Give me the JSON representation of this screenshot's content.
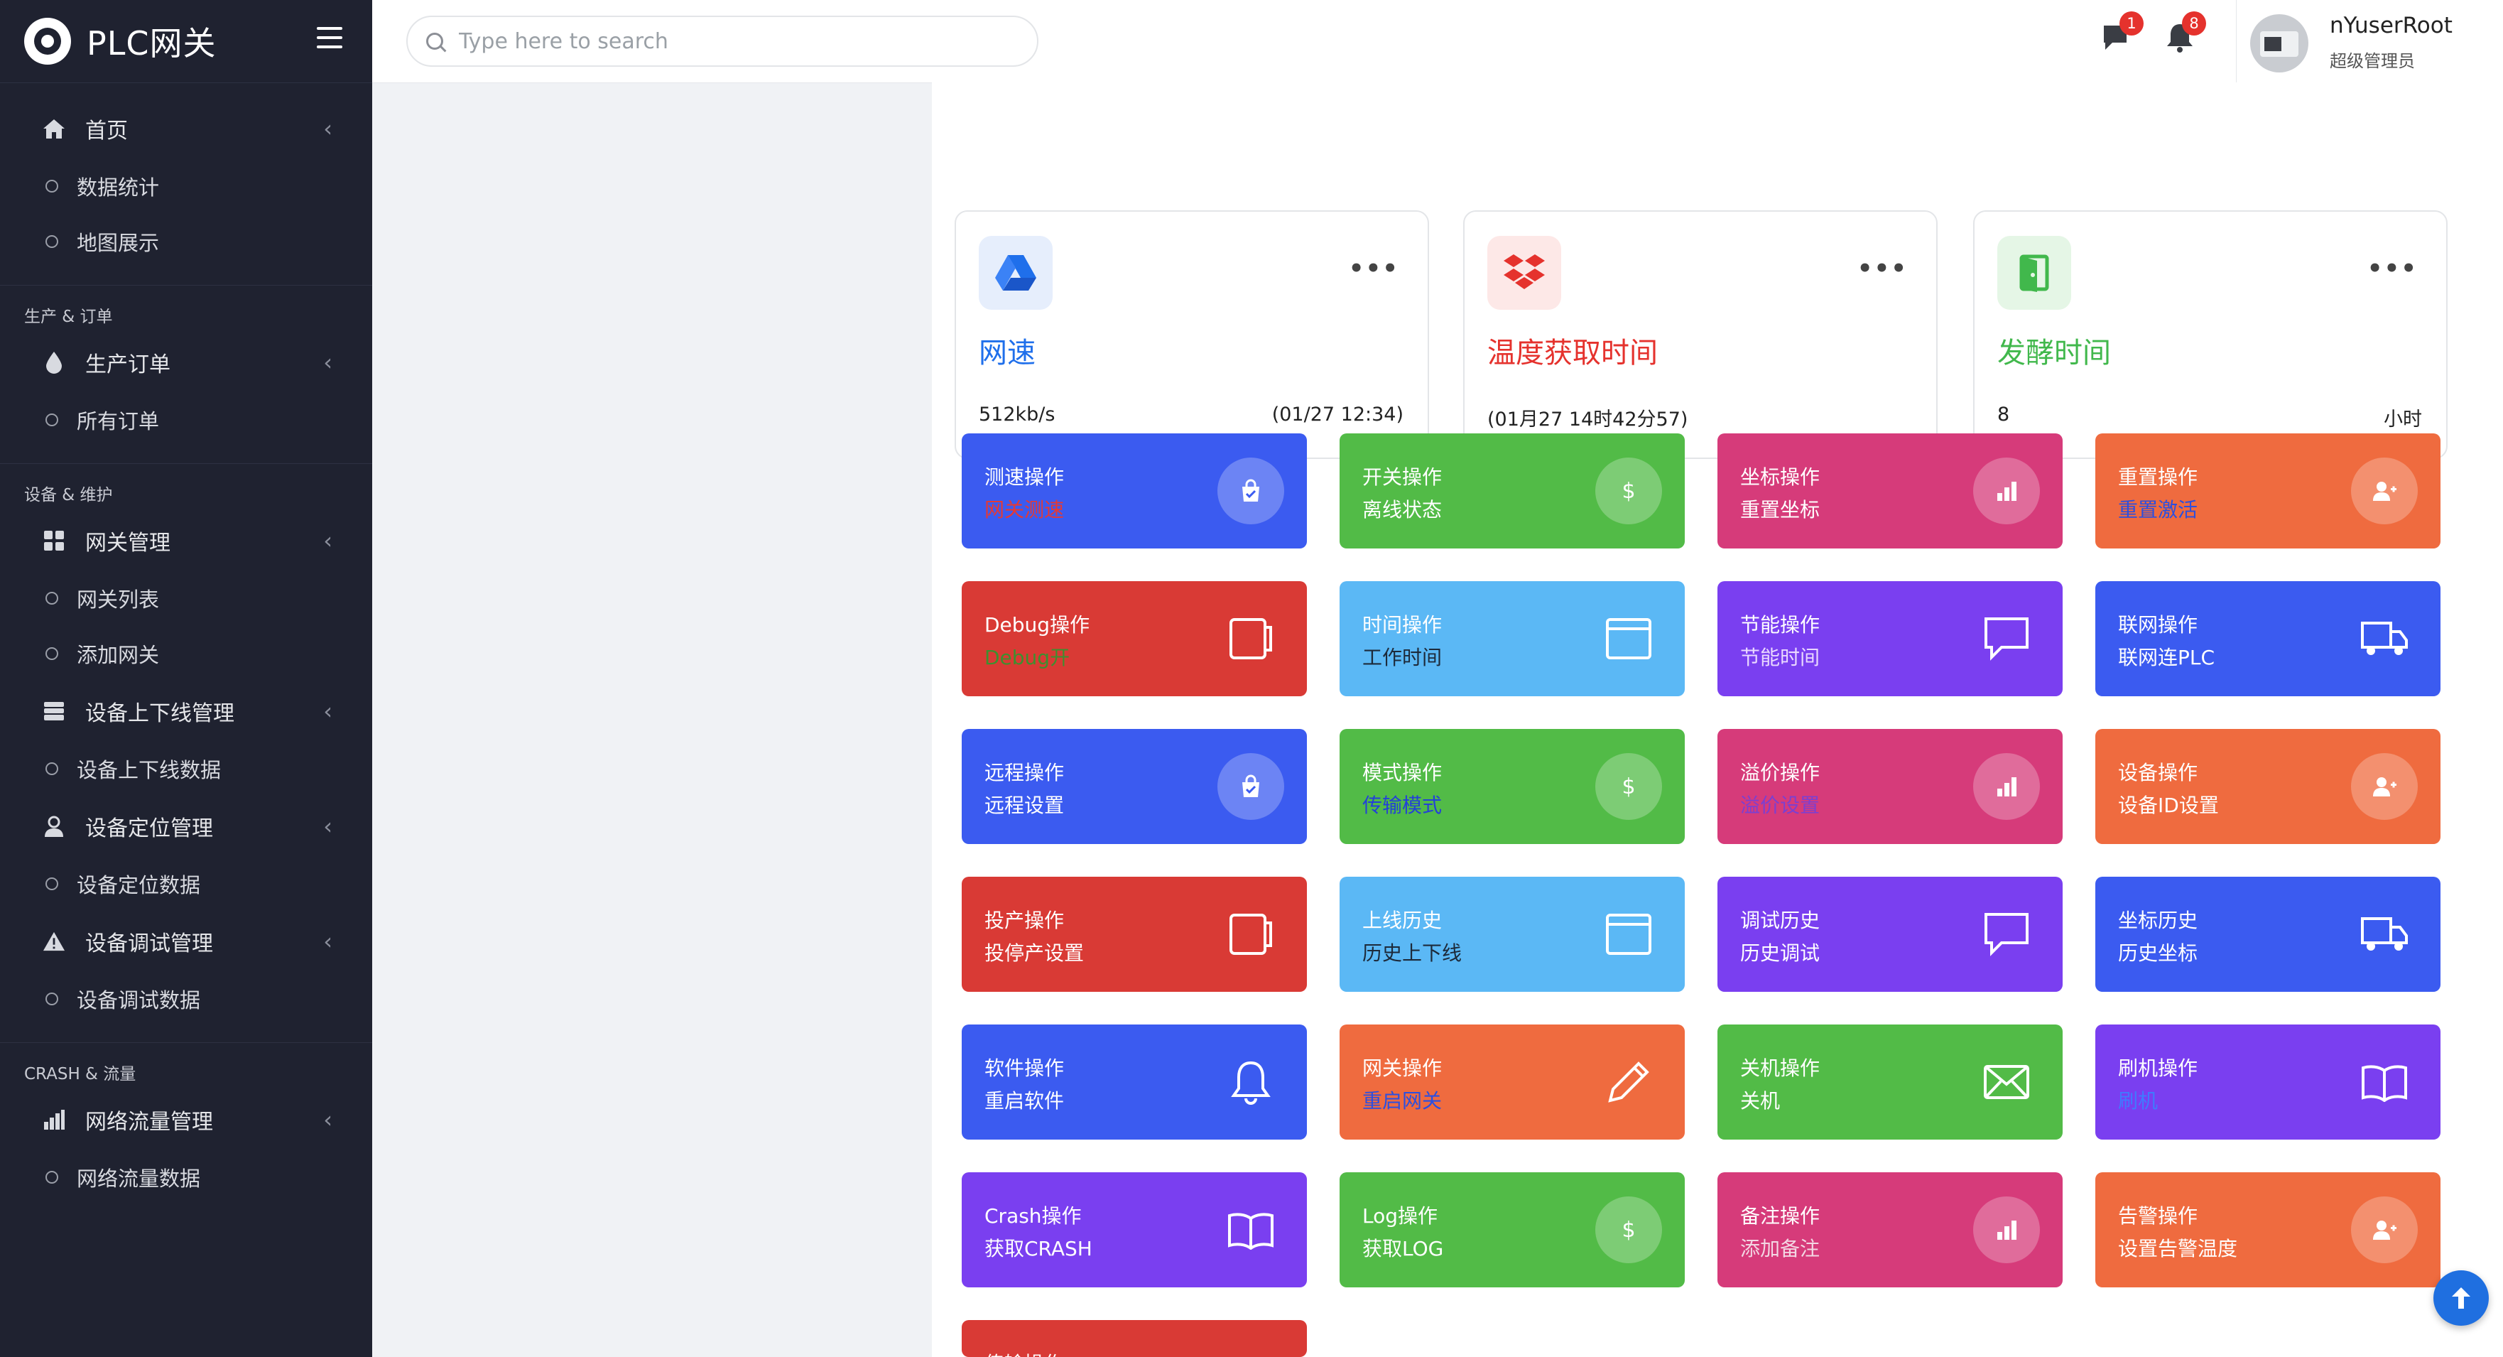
{
  "brand": {
    "title": "PLC网关"
  },
  "search": {
    "placeholder": "Type here to search"
  },
  "notifications": {
    "messages_count": "1",
    "alerts_count": "8"
  },
  "user": {
    "name": "nYuserRoot",
    "role": "超级管理员"
  },
  "sidebar": {
    "home": {
      "label": "首页",
      "children": [
        "数据统计",
        "地图展示"
      ]
    },
    "section_production": "生产 & 订单",
    "orders": {
      "label": "生产订单",
      "children": [
        "所有订单"
      ]
    },
    "section_devices": "设备 & 维护",
    "gateway": {
      "label": "网关管理",
      "children": [
        "网关列表",
        "添加网关"
      ]
    },
    "online": {
      "label": "设备上下线管理",
      "children": [
        "设备上下线数据"
      ]
    },
    "location": {
      "label": "设备定位管理",
      "children": [
        "设备定位数据"
      ]
    },
    "debug": {
      "label": "设备调试管理",
      "children": [
        "设备调试数据"
      ]
    },
    "section_crash": "CRASH & 流量",
    "traffic": {
      "label": "网络流量管理",
      "children": [
        "网络流量数据"
      ]
    }
  },
  "stats": [
    {
      "title": "网速",
      "value": "512kb/s",
      "side": "(01/27 12:34)",
      "icon": "google-drive-icon",
      "color": "#1f6feb",
      "bg": "#e6eefc"
    },
    {
      "title": "温度获取时间",
      "value": "(01月27 14时42分57)",
      "side": "",
      "icon": "dropbox-icon",
      "color": "#e5322d",
      "bg": "#fde8e7"
    },
    {
      "title": "发酵时间",
      "value": "8",
      "side": "小时",
      "icon": "door-icon",
      "color": "#41b84c",
      "bg": "#e5f6e6"
    }
  ],
  "tiles": [
    {
      "label": "测速操作",
      "sub": "网关测速",
      "bg": "#3b5bf0",
      "subColor": "#e53935",
      "icon": "shopping-bag-icon"
    },
    {
      "label": "开关操作",
      "sub": "离线状态",
      "bg": "#52bb47",
      "subColor": "#ffffff",
      "icon": "dollar-icon"
    },
    {
      "label": "坐标操作",
      "sub": "重置坐标",
      "bg": "#d63b7a",
      "subColor": "#ffffff",
      "icon": "bar-chart-icon"
    },
    {
      "label": "重置操作",
      "sub": "重置激活",
      "bg": "#ef6b3f",
      "subColor": "#2b4fe0",
      "icon": "user-plus-icon"
    },
    {
      "label": "Debug操作",
      "sub": "Debug开",
      "bg": "#d93a35",
      "subColor": "#3e8f2f",
      "icon": "tablet-icon"
    },
    {
      "label": "时间操作",
      "sub": "工作时间",
      "bg": "#5bb8f5",
      "subColor": "#1d2a3a",
      "icon": "browser-icon"
    },
    {
      "label": "节能操作",
      "sub": "节能时间",
      "bg": "#7a3ff0",
      "subColor": "#ead8ff",
      "icon": "chat-icon"
    },
    {
      "label": "联网操作",
      "sub": "联网连PLC",
      "bg": "#3b5bf0",
      "subColor": "#ffffff",
      "icon": "truck-icon"
    },
    {
      "label": "远程操作",
      "sub": "远程设置",
      "bg": "#3b5bf0",
      "subColor": "#ffffff",
      "icon": "shopping-bag-icon"
    },
    {
      "label": "模式操作",
      "sub": "传输模式",
      "bg": "#52bb47",
      "subColor": "#2340d8",
      "icon": "dollar-icon"
    },
    {
      "label": "溢价操作",
      "sub": "溢价设置",
      "bg": "#d63b7a",
      "subColor": "#7d3fd0",
      "icon": "bar-chart-icon"
    },
    {
      "label": "设备操作",
      "sub": "设备ID设置",
      "bg": "#ef6b3f",
      "subColor": "#ffffff",
      "icon": "user-plus-icon"
    },
    {
      "label": "投产操作",
      "sub": "投停产设置",
      "bg": "#d93a35",
      "subColor": "#ffffff",
      "icon": "tablet-icon"
    },
    {
      "label": "上线历史",
      "sub": "历史上下线",
      "bg": "#5bb8f5",
      "subColor": "#1d2a3a",
      "icon": "browser-icon"
    },
    {
      "label": "调试历史",
      "sub": "历史调试",
      "bg": "#7a3ff0",
      "subColor": "#ffffff",
      "icon": "chat-icon"
    },
    {
      "label": "坐标历史",
      "sub": "历史坐标",
      "bg": "#3b5bf0",
      "subColor": "#ffffff",
      "icon": "truck-icon"
    },
    {
      "label": "软件操作",
      "sub": "重启软件",
      "bg": "#3b5bf0",
      "subColor": "#ffffff",
      "icon": "bell-icon"
    },
    {
      "label": "网关操作",
      "sub": "重启网关",
      "bg": "#ef6b3f",
      "subColor": "#2b4fe0",
      "icon": "pencil-icon"
    },
    {
      "label": "关机操作",
      "sub": "关机",
      "bg": "#52bb47",
      "subColor": "#ffffff",
      "icon": "envelope-icon"
    },
    {
      "label": "刷机操作",
      "sub": "刷机",
      "bg": "#7a3ff0",
      "subColor": "#3f7bff",
      "icon": "book-icon"
    },
    {
      "label": "Crash操作",
      "sub": "获取CRASH",
      "bg": "#7a3ff0",
      "subColor": "#ffffff",
      "icon": "book-icon"
    },
    {
      "label": "Log操作",
      "sub": "获取LOG",
      "bg": "#52bb47",
      "subColor": "#ffffff",
      "icon": "dollar-icon"
    },
    {
      "label": "备注操作",
      "sub": "添加备注",
      "bg": "#d63b7a",
      "subColor": "#f3d6e3",
      "icon": "bar-chart-icon"
    },
    {
      "label": "告警操作",
      "sub": "设置告警温度",
      "bg": "#ef6b3f",
      "subColor": "#ffffff",
      "icon": "user-plus-icon"
    },
    {
      "label": "传输操作",
      "sub": "",
      "bg": "#d93a35",
      "subColor": "#ffffff",
      "icon": "tablet-icon"
    }
  ]
}
